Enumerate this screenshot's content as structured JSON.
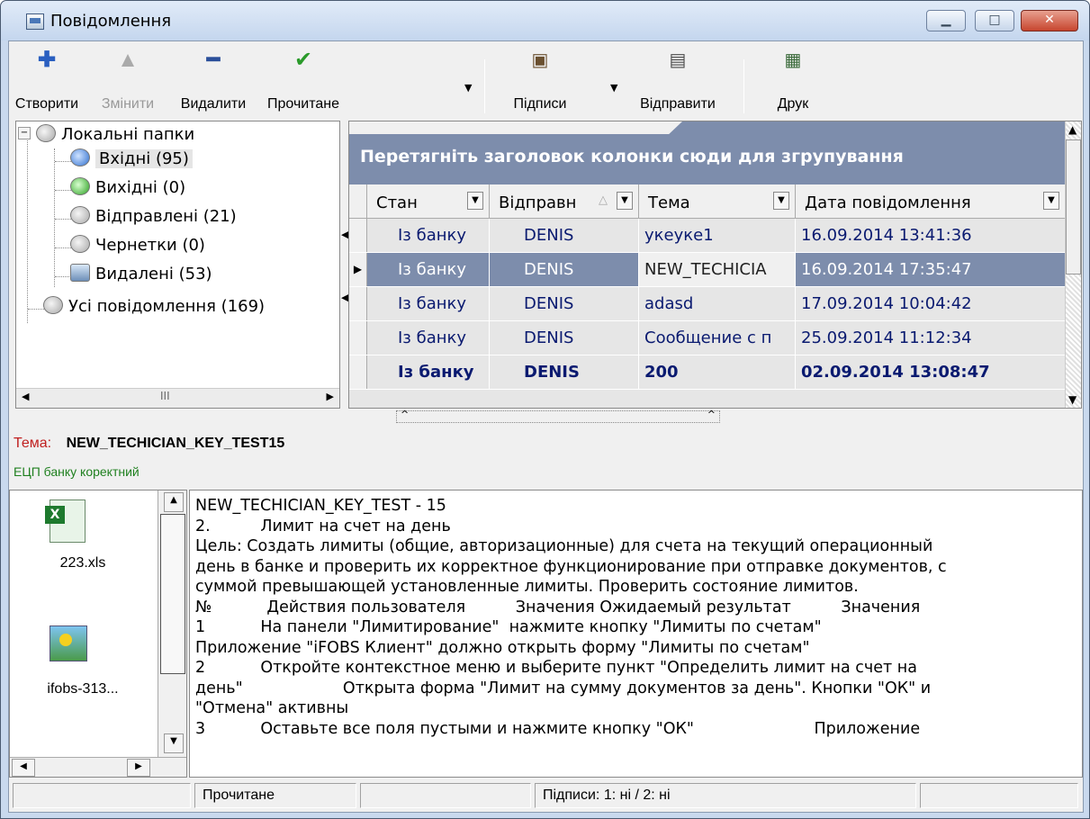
{
  "window": {
    "title": "Повідомлення"
  },
  "toolbar": {
    "create": "Створити",
    "edit": "Змінити",
    "delete": "Видалити",
    "read": "Прочитане",
    "signatures": "Підписи",
    "send": "Відправити",
    "print": "Друк"
  },
  "tree": {
    "root": "Локальні папки",
    "inbox": "Вхідні (95)",
    "outbox": "Вихідні (0)",
    "sent": "Відправлені (21)",
    "drafts": "Чернетки (0)",
    "deleted": "Видалені (53)",
    "all": "Усі повідомлення (169)",
    "scroll_mid": "III"
  },
  "grid": {
    "group_hint": "Перетягніть заголовок колонки сюди для згрупування",
    "columns": [
      "Стан",
      "Відправн",
      "Тема",
      "Дата повідомлення"
    ],
    "rows": [
      {
        "status": "Із банку",
        "sender": "DENIS",
        "subject": "укеуке1",
        "date": "16.09.2014 13:41:36"
      },
      {
        "status": "Із банку",
        "sender": "DENIS",
        "subject": "NEW_TECHICIA",
        "date": "16.09.2014 17:35:47"
      },
      {
        "status": "Із банку",
        "sender": "DENIS",
        "subject": "adasd",
        "date": "17.09.2014 10:04:42"
      },
      {
        "status": "Із банку",
        "sender": "DENIS",
        "subject": "Сообщение с п",
        "date": "25.09.2014 11:12:34"
      },
      {
        "status": "Із банку",
        "sender": "DENIS",
        "subject": "200",
        "date": "02.09.2014 13:08:47"
      }
    ]
  },
  "preview": {
    "subject_label": "Тема:",
    "subject": "NEW_TECHICIAN_KEY_TEST15",
    "signature_status": "ЕЦП банку коректний"
  },
  "attachments": [
    {
      "name": "223.xls",
      "icon": "excel-file-icon"
    },
    {
      "name": "ifobs-313...",
      "icon": "image-file-icon"
    }
  ],
  "body_lines": [
    "NEW_TECHICIAN_KEY_TEST - 15",
    "2.          Лимит на счет на день",
    "Цель: Создать лимиты (общие, авторизационные) для счета на текущий операционный",
    "день в банке и проверить их корректное функционирование при отправке документов, с",
    "суммой превышающей установленные лимиты. Проверить состояние лимитов.",
    "№           Действия пользователя          Значения Ожидаемый результат          Значения",
    "1           На панели \"Лимитирование\"  нажмите кнопку \"Лимиты по счетам\"",
    "Приложение \"iFOBS Клиент\" должно открыть форму \"Лимиты по счетам\"",
    "2           Откройте контекстное меню и выберите пункт \"Определить лимит на счет на",
    "день\"                    Открыта форма \"Лимит на сумму документов за день\". Кнопки \"ОК\" и",
    "\"Отмена\" активны",
    "3           Оставьте все поля пустыми и нажмите кнопку \"ОК\"                        Приложение"
  ],
  "statusbar": {
    "read": "Прочитане",
    "signatures": "Підписи: 1: ні / 2: ні"
  }
}
